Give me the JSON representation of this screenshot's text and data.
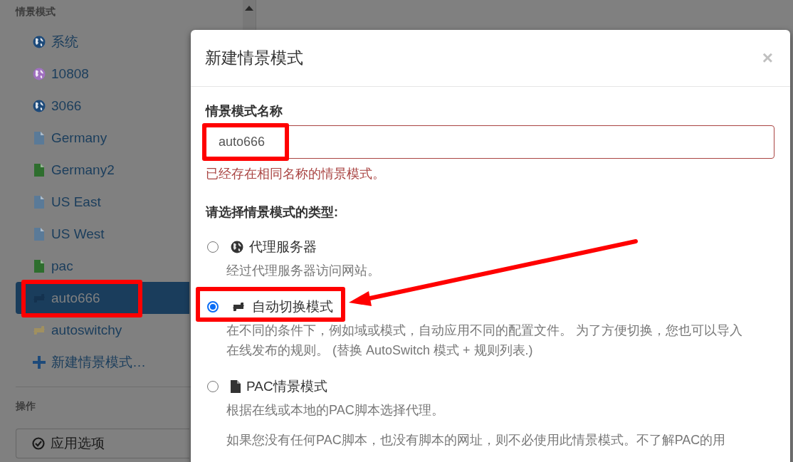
{
  "sidebar": {
    "profiles_title": "情景模式",
    "profiles": [
      {
        "label": "系统",
        "kind": "globe",
        "color": "#1d4a7a",
        "selected": false,
        "highlighted": false
      },
      {
        "label": "10808",
        "kind": "globe",
        "color": "#a070c0",
        "selected": false,
        "highlighted": false
      },
      {
        "label": "3066",
        "kind": "globe",
        "color": "#1d4a7a",
        "selected": false,
        "highlighted": false
      },
      {
        "label": "Germany",
        "kind": "file",
        "color": "#5a7a98",
        "selected": false,
        "highlighted": false
      },
      {
        "label": "Germany2",
        "kind": "file",
        "color": "#2e6e2e",
        "selected": false,
        "highlighted": false
      },
      {
        "label": "US East",
        "kind": "file",
        "color": "#5a7a98",
        "selected": false,
        "highlighted": false
      },
      {
        "label": "US West",
        "kind": "file",
        "color": "#5a7a98",
        "selected": false,
        "highlighted": false
      },
      {
        "label": "pac",
        "kind": "file",
        "color": "#2e6e2e",
        "selected": false,
        "highlighted": false
      },
      {
        "label": "auto666",
        "kind": "switch",
        "color": "#14324f",
        "selected": true,
        "highlighted": true
      },
      {
        "label": "autoswitchy",
        "kind": "switch",
        "color": "#a09060",
        "selected": false,
        "highlighted": false
      },
      {
        "label": "新建情景模式…",
        "kind": "add",
        "color": "#1d4a7a",
        "selected": false,
        "highlighted": false
      }
    ],
    "actions_title": "操作",
    "actions": [
      {
        "label": "应用选项"
      }
    ]
  },
  "dialog": {
    "title": "新建情景模式",
    "close": "×",
    "name_label": "情景模式名称",
    "name_value": "auto666",
    "name_highlighted": true,
    "error": "已经存在相同名称的情景模式。",
    "type_label": "请选择情景模式的类型:",
    "options": [
      {
        "label": "代理服务器",
        "kind": "globe",
        "selected": false,
        "highlighted": false,
        "descriptions": [
          "经过代理服务器访问网站。"
        ]
      },
      {
        "label": "自动切换模式",
        "kind": "switch",
        "selected": true,
        "highlighted": true,
        "descriptions": [
          "在不同的条件下，例如域或模式，自动应用不同的配置文件。 为了方便切换，您也可以导入在线发布的规则。 (替换 AutoSwitch 模式 + 规则列表.)"
        ]
      },
      {
        "label": "PAC情景模式",
        "kind": "file",
        "selected": false,
        "highlighted": false,
        "descriptions": [
          "根据在线或本地的PAC脚本选择代理。",
          "如果您没有任何PAC脚本，也没有脚本的网址，则不必使用此情景模式。不了解PAC的用"
        ]
      }
    ]
  },
  "annotation_arrow": true
}
